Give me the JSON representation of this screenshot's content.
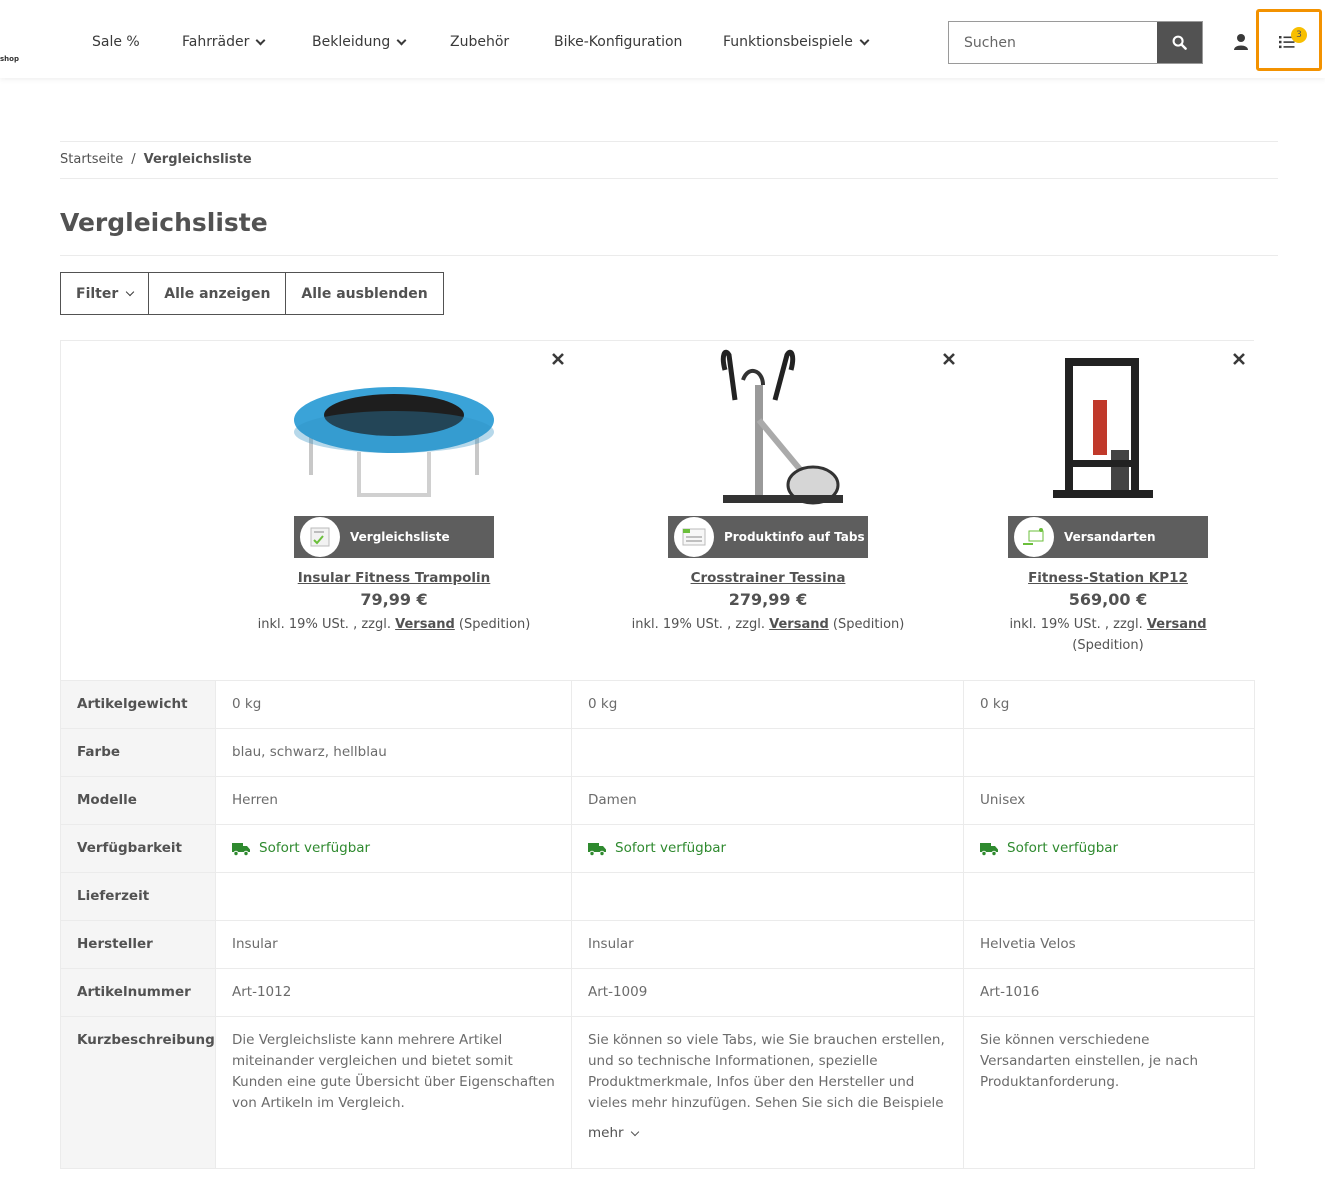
{
  "header": {
    "logo_text": "shop",
    "nav": [
      {
        "label": "Sale %"
      },
      {
        "label": "Fahrräder"
      },
      {
        "label": "Bekleidung"
      },
      {
        "label": "Zubehör"
      },
      {
        "label": "Bike-Konfiguration"
      },
      {
        "label": "Funktionsbeispiele"
      }
    ],
    "search_placeholder": "Suchen",
    "compare_count": "3",
    "highlight_color": "#f39200",
    "badge_color": "#f8bf00"
  },
  "breadcrumb": {
    "home": "Startseite",
    "separator": "/",
    "current": "Vergleichsliste"
  },
  "page": {
    "title": "Vergleichsliste",
    "buttons": {
      "filter": "Filter",
      "show_all": "Alle anzeigen",
      "hide_all": "Alle ausblenden"
    }
  },
  "products": [
    {
      "name": "Insular Fitness Trampolin",
      "price": "79,99 €",
      "tax_prefix": "inkl. 19% USt. , zzgl.",
      "shipping_link": "Versand",
      "tax_suffix": "(Spedition)",
      "banner_label": "Vergleichsliste"
    },
    {
      "name": "Crosstrainer Tessina",
      "price": "279,99 €",
      "tax_prefix": "inkl. 19% USt. , zzgl.",
      "shipping_link": "Versand",
      "tax_suffix": "(Spedition)",
      "banner_label": "Produktinfo auf Tabs"
    },
    {
      "name": "Fitness-Station KP12",
      "price": "569,00 €",
      "tax_prefix": "inkl. 19% USt. , zzgl.",
      "shipping_link": "Versand",
      "tax_suffix": "(Spedition)",
      "banner_label": "Versandarten"
    }
  ],
  "comparison": {
    "rows": [
      {
        "label": "Artikelgewicht",
        "values": [
          "0 kg",
          "0 kg",
          "0 kg"
        ]
      },
      {
        "label": "Farbe",
        "values": [
          "blau, schwarz, hellblau",
          "",
          ""
        ]
      },
      {
        "label": "Modelle",
        "values": [
          "Herren",
          "Damen",
          "Unisex"
        ]
      },
      {
        "label": "Verfügbarkeit",
        "values": [
          "Sofort verfügbar",
          "Sofort verfügbar",
          "Sofort verfügbar"
        ]
      },
      {
        "label": "Lieferzeit",
        "values": [
          "",
          "",
          ""
        ]
      },
      {
        "label": "Hersteller",
        "values": [
          "Insular",
          "Insular",
          "Helvetia Velos"
        ]
      },
      {
        "label": "Artikelnummer",
        "values": [
          "Art-1012",
          "Art-1009",
          "Art-1016"
        ]
      },
      {
        "label": "Kurzbeschreibung",
        "values": [
          "Die Vergleichsliste kann mehrere Artikel miteinander vergleichen und bietet somit Kunden eine gute Übersicht über Eigenschaften von Artikeln im Vergleich.",
          "Sie können so viele Tabs, wie Sie brauchen erstellen, und so technische Informationen, spezielle Produktmerkmale, Infos über den Hersteller und vieles mehr hinzufügen. Sehen Sie sich die Beispiele",
          "Sie können verschiedene Versandarten einstellen, je nach Produktanforderung."
        ]
      }
    ],
    "more_label": "mehr",
    "availability_color": "#2f8a2f"
  }
}
